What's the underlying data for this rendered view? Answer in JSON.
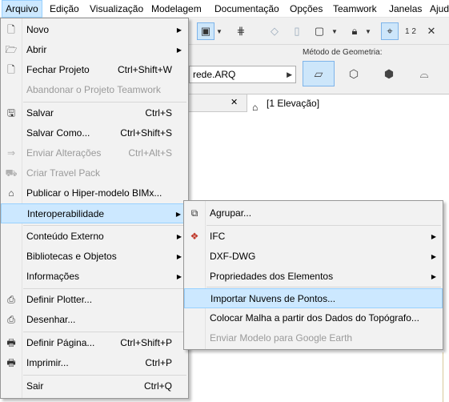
{
  "menubar": {
    "items": [
      "Arquivo",
      "Edição",
      "Visualização",
      "Modelagem",
      "Documentação",
      "Opções",
      "Teamwork",
      "Janelas",
      "Ajud"
    ]
  },
  "toolbar": {
    "icons": [
      "view-3d-icon",
      "dropdown-arrow-icon",
      "grid-icon",
      "plane-icon",
      "wall-icon",
      "frame-icon",
      "dropdown-arrow-icon",
      "lock-icon",
      "dropdown-arrow-icon",
      "snap-icon",
      "measure-icon",
      "close-x-icon"
    ],
    "measure_text": "1 2"
  },
  "infobox": {
    "combo_value": "rede.ARQ",
    "geometry_label": "Método de Geometria:"
  },
  "tabs": {
    "close_glyph": "✕",
    "active_tab": "[1 Elevação]"
  },
  "file_menu": {
    "items": [
      {
        "label": "Novo",
        "shortcut": "",
        "submenu": true,
        "disabled": false,
        "icon": "new-file-icon"
      },
      {
        "label": "Abrir",
        "shortcut": "",
        "submenu": true,
        "disabled": false,
        "icon": "open-folder-icon"
      },
      {
        "label": "Fechar Projeto",
        "shortcut": "Ctrl+Shift+W",
        "submenu": false,
        "disabled": false,
        "icon": "close-project-icon"
      },
      {
        "label": "Abandonar o Projeto Teamwork",
        "shortcut": "",
        "submenu": false,
        "disabled": true,
        "icon": ""
      },
      {
        "label": "Salvar",
        "shortcut": "Ctrl+S",
        "submenu": false,
        "disabled": false,
        "icon": "save-icon"
      },
      {
        "label": "Salvar Como...",
        "shortcut": "Ctrl+Shift+S",
        "submenu": false,
        "disabled": false,
        "icon": ""
      },
      {
        "label": "Enviar Alterações",
        "shortcut": "Ctrl+Alt+S",
        "submenu": false,
        "disabled": true,
        "icon": "send-arrow-icon"
      },
      {
        "label": "Criar Travel Pack",
        "shortcut": "",
        "submenu": false,
        "disabled": true,
        "icon": "travel-pack-icon"
      },
      {
        "label": "Publicar o Hiper-modelo BIMx...",
        "shortcut": "",
        "submenu": false,
        "disabled": false,
        "icon": "bimx-icon"
      },
      {
        "label": "Interoperabilidade",
        "shortcut": "",
        "submenu": true,
        "disabled": false,
        "icon": ""
      },
      {
        "label": "Conteúdo Externo",
        "shortcut": "",
        "submenu": true,
        "disabled": false,
        "icon": ""
      },
      {
        "label": "Bibliotecas e Objetos",
        "shortcut": "",
        "submenu": true,
        "disabled": false,
        "icon": ""
      },
      {
        "label": "Informações",
        "shortcut": "",
        "submenu": true,
        "disabled": false,
        "icon": ""
      },
      {
        "label": "Definir Plotter...",
        "shortcut": "",
        "submenu": false,
        "disabled": false,
        "icon": "plotter-icon"
      },
      {
        "label": "Desenhar...",
        "shortcut": "",
        "submenu": false,
        "disabled": false,
        "icon": "plot-icon"
      },
      {
        "label": "Definir Página...",
        "shortcut": "Ctrl+Shift+P",
        "submenu": false,
        "disabled": false,
        "icon": "page-setup-icon"
      },
      {
        "label": "Imprimir...",
        "shortcut": "Ctrl+P",
        "submenu": false,
        "disabled": false,
        "icon": "printer-icon"
      },
      {
        "label": "Sair",
        "shortcut": "Ctrl+Q",
        "submenu": false,
        "disabled": false,
        "icon": ""
      }
    ]
  },
  "interop_menu": {
    "items": [
      {
        "label": "Agrupar...",
        "submenu": false,
        "disabled": false,
        "icon": "merge-icon"
      },
      {
        "label": "IFC",
        "submenu": true,
        "disabled": false,
        "icon": "ifc-icon"
      },
      {
        "label": "DXF-DWG",
        "submenu": true,
        "disabled": false,
        "icon": ""
      },
      {
        "label": "Propriedades dos Elementos",
        "submenu": true,
        "disabled": false,
        "icon": ""
      },
      {
        "label": "Importar Nuvens de Pontos...",
        "submenu": false,
        "disabled": false,
        "icon": ""
      },
      {
        "label": "Colocar Malha a partir dos Dados do Topógrafo...",
        "submenu": false,
        "disabled": false,
        "icon": ""
      },
      {
        "label": "Enviar Modelo para Google Earth",
        "submenu": false,
        "disabled": true,
        "icon": ""
      }
    ]
  },
  "colors": {
    "highlight": "#cce8ff",
    "highlight_border": "#99d1ff",
    "menu_bg": "#f2f2f2",
    "disabled_text": "#9a9a9a"
  }
}
